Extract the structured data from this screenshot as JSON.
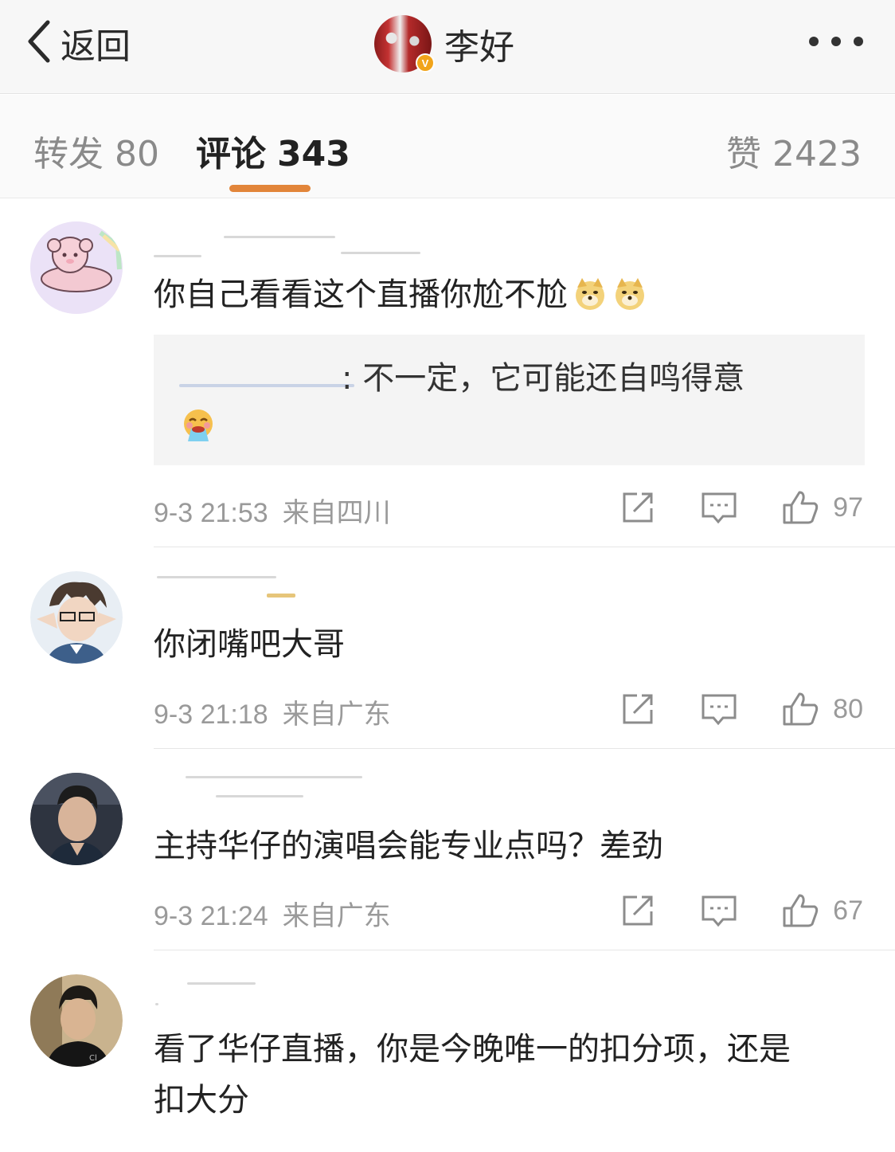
{
  "navbar": {
    "back_label": "返回",
    "profile_name": "李好",
    "verified_badge": "V"
  },
  "tabs": [
    {
      "label": "转发",
      "count": "80"
    },
    {
      "label": "评论",
      "count": "343"
    },
    {
      "label": "赞",
      "count": "2423"
    }
  ],
  "colors": {
    "accent": "#e2853a",
    "verified": "#f1a41a",
    "meta_text": "#9a9a9a"
  },
  "comments": [
    {
      "text": "你自己看看这个直播你尬不尬",
      "emojis": [
        "doge-emoji",
        "doge-emoji"
      ],
      "reply": {
        "text": ": 不一定，它可能还自鸣得意",
        "emoji": "vomit-emoji"
      },
      "date": "9-3 21:53",
      "location": "来自四川",
      "likes": "97"
    },
    {
      "text": "你闭嘴吧大哥",
      "date": "9-3 21:18",
      "location": "来自广东",
      "likes": "80"
    },
    {
      "text": "主持华仔的演唱会能专业点吗？差劲",
      "date": "9-3 21:24",
      "location": "来自广东",
      "likes": "67"
    },
    {
      "text_line1": "看了华仔直播，你是今晚唯一的扣分项，还是",
      "text_line2": "扣大分"
    }
  ]
}
